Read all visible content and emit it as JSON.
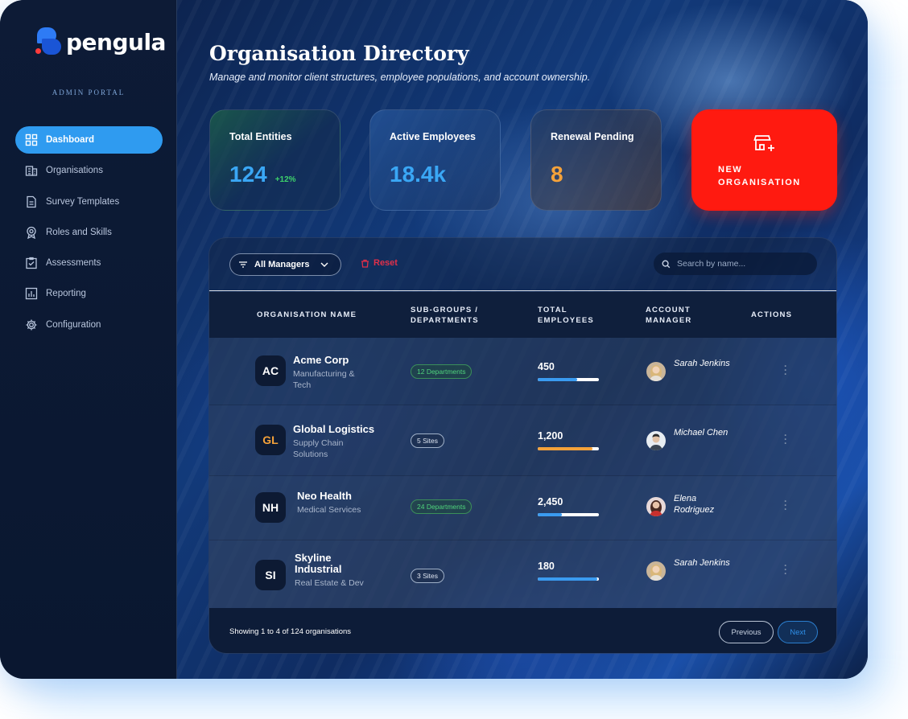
{
  "brand": {
    "name": "pengula",
    "portal_label": "ADMIN PORTAL"
  },
  "sidebar": {
    "items": [
      {
        "label": "Dashboard",
        "icon": "grid-icon",
        "active": true
      },
      {
        "label": "Organisations",
        "icon": "building-icon"
      },
      {
        "label": "Survey Templates",
        "icon": "document-icon"
      },
      {
        "label": "Roles and Skills",
        "icon": "badge-icon"
      },
      {
        "label": "Assessments",
        "icon": "clipboard-check-icon"
      },
      {
        "label": "Reporting",
        "icon": "bar-chart-icon"
      },
      {
        "label": "Configuration",
        "icon": "gear-icon"
      }
    ]
  },
  "header": {
    "title": "Organisation Directory",
    "subtitle": "Manage and monitor client structures, employee populations, and account ownership."
  },
  "stats": [
    {
      "label": "Total Entities",
      "value": "124",
      "delta": "+12%",
      "color": "#3aa7f5"
    },
    {
      "label": "Active Employees",
      "value": "18.4k",
      "color": "#3aa7f5"
    },
    {
      "label": "Renewal Pending",
      "value": "8",
      "color": "#f5a23a"
    }
  ],
  "new_org": {
    "label": "NEW ORGANISATION",
    "icon": "add-store-icon"
  },
  "toolbar": {
    "filter_label": "All Managers",
    "reset_label": "Reset",
    "search_placeholder": "Search by name..."
  },
  "table": {
    "headers": {
      "name": "ORGANISATION NAME",
      "subgroups_1": "SUB-GROUPS /",
      "subgroups_2": "DEPARTMENTS",
      "employees_1": "TOTAL",
      "employees_2": "EMPLOYEES",
      "manager_1": "ACCOUNT",
      "manager_2": "MANAGER",
      "actions": "ACTIONS"
    },
    "rows": [
      {
        "initials": "AC",
        "initials_color": "#ffffff",
        "name": "Acme Corp",
        "sector": "Manufacturing & Tech",
        "subgroups": "12 Departments",
        "chip": "green",
        "employees": "450",
        "fill": 0.64,
        "fill_color": "#3a9bf0",
        "manager": "Sarah Jenkins"
      },
      {
        "initials": "GL",
        "initials_color": "#f5a23a",
        "name": "Global Logistics",
        "sector": "Supply Chain Solutions",
        "subgroups": "5 Sites",
        "chip": "gray",
        "employees": "1,200",
        "fill": 0.9,
        "fill_color": "#f5a23a",
        "manager": "Michael Chen"
      },
      {
        "initials": "NH",
        "initials_color": "#ffffff",
        "name": "Neo Health",
        "sector": "Medical Services",
        "subgroups": "24 Departments",
        "chip": "green",
        "employees": "2,450",
        "fill": 0.4,
        "fill_color": "#3a9bf0",
        "manager": "Elena Rodriguez"
      },
      {
        "initials": "SI",
        "initials_color": "#ffffff",
        "name": "Skyline Industrial",
        "sector": "Real Estate & Dev",
        "subgroups": "3 Sites",
        "chip": "gray",
        "employees": "180",
        "fill": 0.98,
        "fill_color": "#3a9bf0",
        "manager": "Sarah Jenkins"
      }
    ]
  },
  "pagination": {
    "summary": "Showing 1 to 4 of 124 organisations",
    "prev": "Previous",
    "next": "Next"
  }
}
